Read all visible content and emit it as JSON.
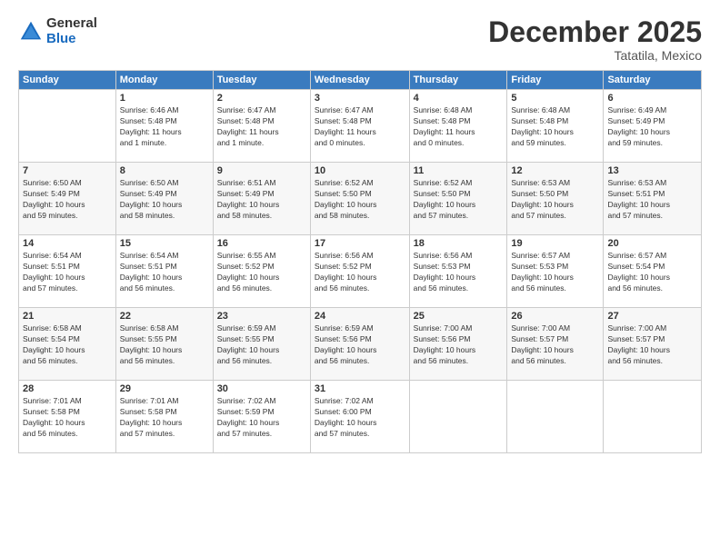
{
  "header": {
    "logo_general": "General",
    "logo_blue": "Blue",
    "month_title": "December 2025",
    "location": "Tatatila, Mexico"
  },
  "days_of_week": [
    "Sunday",
    "Monday",
    "Tuesday",
    "Wednesday",
    "Thursday",
    "Friday",
    "Saturday"
  ],
  "weeks": [
    [
      {
        "day": "",
        "info": ""
      },
      {
        "day": "1",
        "info": "Sunrise: 6:46 AM\nSunset: 5:48 PM\nDaylight: 11 hours\nand 1 minute."
      },
      {
        "day": "2",
        "info": "Sunrise: 6:47 AM\nSunset: 5:48 PM\nDaylight: 11 hours\nand 1 minute."
      },
      {
        "day": "3",
        "info": "Sunrise: 6:47 AM\nSunset: 5:48 PM\nDaylight: 11 hours\nand 0 minutes."
      },
      {
        "day": "4",
        "info": "Sunrise: 6:48 AM\nSunset: 5:48 PM\nDaylight: 11 hours\nand 0 minutes."
      },
      {
        "day": "5",
        "info": "Sunrise: 6:48 AM\nSunset: 5:48 PM\nDaylight: 10 hours\nand 59 minutes."
      },
      {
        "day": "6",
        "info": "Sunrise: 6:49 AM\nSunset: 5:49 PM\nDaylight: 10 hours\nand 59 minutes."
      }
    ],
    [
      {
        "day": "7",
        "info": "Sunrise: 6:50 AM\nSunset: 5:49 PM\nDaylight: 10 hours\nand 59 minutes."
      },
      {
        "day": "8",
        "info": "Sunrise: 6:50 AM\nSunset: 5:49 PM\nDaylight: 10 hours\nand 58 minutes."
      },
      {
        "day": "9",
        "info": "Sunrise: 6:51 AM\nSunset: 5:49 PM\nDaylight: 10 hours\nand 58 minutes."
      },
      {
        "day": "10",
        "info": "Sunrise: 6:52 AM\nSunset: 5:50 PM\nDaylight: 10 hours\nand 58 minutes."
      },
      {
        "day": "11",
        "info": "Sunrise: 6:52 AM\nSunset: 5:50 PM\nDaylight: 10 hours\nand 57 minutes."
      },
      {
        "day": "12",
        "info": "Sunrise: 6:53 AM\nSunset: 5:50 PM\nDaylight: 10 hours\nand 57 minutes."
      },
      {
        "day": "13",
        "info": "Sunrise: 6:53 AM\nSunset: 5:51 PM\nDaylight: 10 hours\nand 57 minutes."
      }
    ],
    [
      {
        "day": "14",
        "info": "Sunrise: 6:54 AM\nSunset: 5:51 PM\nDaylight: 10 hours\nand 57 minutes."
      },
      {
        "day": "15",
        "info": "Sunrise: 6:54 AM\nSunset: 5:51 PM\nDaylight: 10 hours\nand 56 minutes."
      },
      {
        "day": "16",
        "info": "Sunrise: 6:55 AM\nSunset: 5:52 PM\nDaylight: 10 hours\nand 56 minutes."
      },
      {
        "day": "17",
        "info": "Sunrise: 6:56 AM\nSunset: 5:52 PM\nDaylight: 10 hours\nand 56 minutes."
      },
      {
        "day": "18",
        "info": "Sunrise: 6:56 AM\nSunset: 5:53 PM\nDaylight: 10 hours\nand 56 minutes."
      },
      {
        "day": "19",
        "info": "Sunrise: 6:57 AM\nSunset: 5:53 PM\nDaylight: 10 hours\nand 56 minutes."
      },
      {
        "day": "20",
        "info": "Sunrise: 6:57 AM\nSunset: 5:54 PM\nDaylight: 10 hours\nand 56 minutes."
      }
    ],
    [
      {
        "day": "21",
        "info": "Sunrise: 6:58 AM\nSunset: 5:54 PM\nDaylight: 10 hours\nand 56 minutes."
      },
      {
        "day": "22",
        "info": "Sunrise: 6:58 AM\nSunset: 5:55 PM\nDaylight: 10 hours\nand 56 minutes."
      },
      {
        "day": "23",
        "info": "Sunrise: 6:59 AM\nSunset: 5:55 PM\nDaylight: 10 hours\nand 56 minutes."
      },
      {
        "day": "24",
        "info": "Sunrise: 6:59 AM\nSunset: 5:56 PM\nDaylight: 10 hours\nand 56 minutes."
      },
      {
        "day": "25",
        "info": "Sunrise: 7:00 AM\nSunset: 5:56 PM\nDaylight: 10 hours\nand 56 minutes."
      },
      {
        "day": "26",
        "info": "Sunrise: 7:00 AM\nSunset: 5:57 PM\nDaylight: 10 hours\nand 56 minutes."
      },
      {
        "day": "27",
        "info": "Sunrise: 7:00 AM\nSunset: 5:57 PM\nDaylight: 10 hours\nand 56 minutes."
      }
    ],
    [
      {
        "day": "28",
        "info": "Sunrise: 7:01 AM\nSunset: 5:58 PM\nDaylight: 10 hours\nand 56 minutes."
      },
      {
        "day": "29",
        "info": "Sunrise: 7:01 AM\nSunset: 5:58 PM\nDaylight: 10 hours\nand 57 minutes."
      },
      {
        "day": "30",
        "info": "Sunrise: 7:02 AM\nSunset: 5:59 PM\nDaylight: 10 hours\nand 57 minutes."
      },
      {
        "day": "31",
        "info": "Sunrise: 7:02 AM\nSunset: 6:00 PM\nDaylight: 10 hours\nand 57 minutes."
      },
      {
        "day": "",
        "info": ""
      },
      {
        "day": "",
        "info": ""
      },
      {
        "day": "",
        "info": ""
      }
    ]
  ]
}
